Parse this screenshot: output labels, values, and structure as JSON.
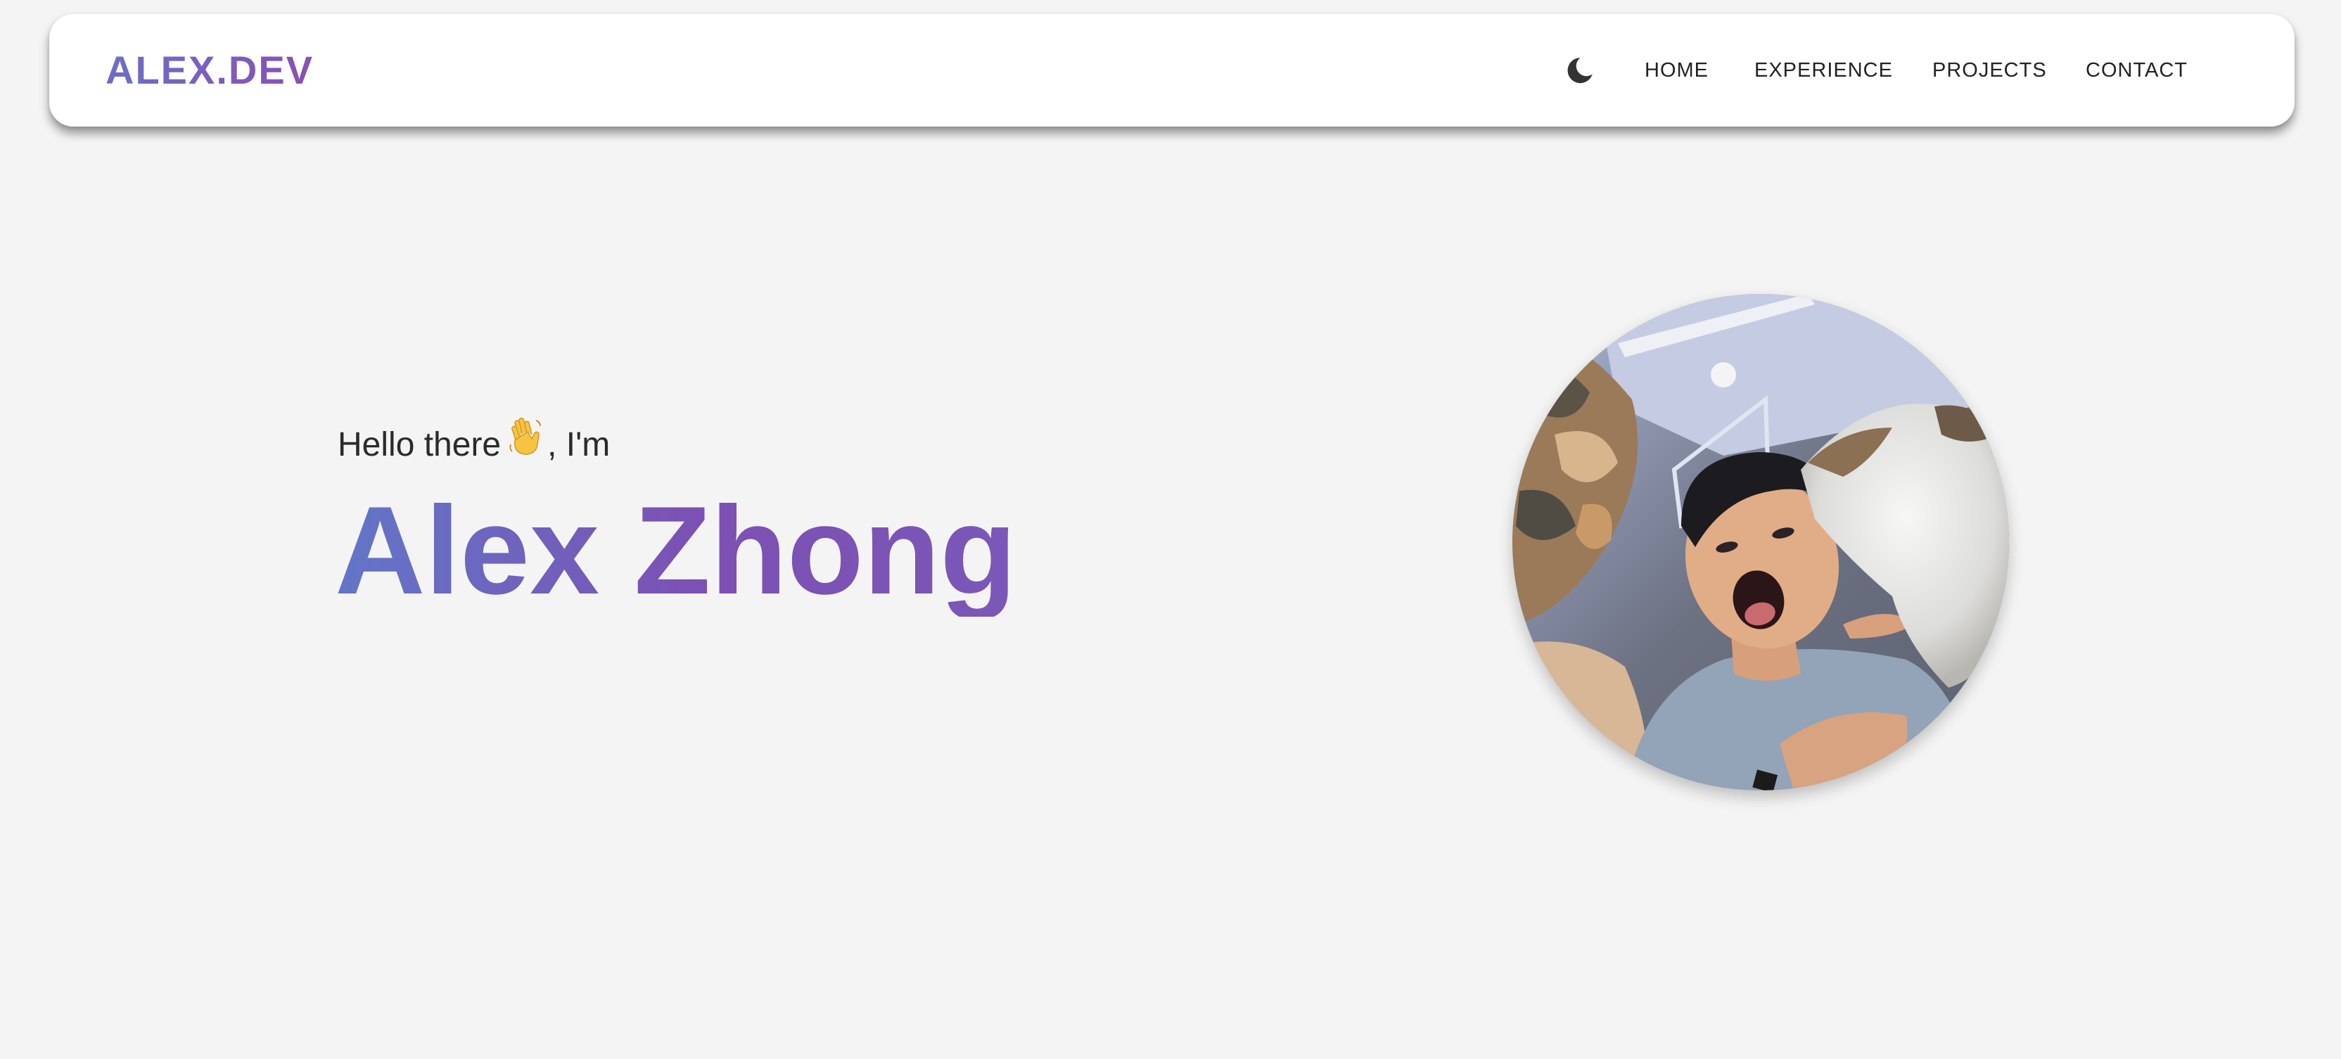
{
  "navbar": {
    "brand": "ALEX.DEV",
    "theme_toggle_icon": "moon-icon",
    "links": [
      {
        "label": "HOME"
      },
      {
        "label": "EXPERIENCE"
      },
      {
        "label": "PROJECTS"
      },
      {
        "label": "CONTACT"
      }
    ]
  },
  "hero": {
    "greeting_prefix": "Hello there",
    "greeting_suffix": ", I'm",
    "wave_icon": "waving-hand-icon",
    "name": "Alex Zhong"
  },
  "avatar": {
    "icon": "profile-photo"
  },
  "colors": {
    "background": "#f4f4f4",
    "navbar": "#ffffff",
    "gradient_start": "#6276c8",
    "gradient_end": "#8a4fb5",
    "text": "#222222"
  }
}
